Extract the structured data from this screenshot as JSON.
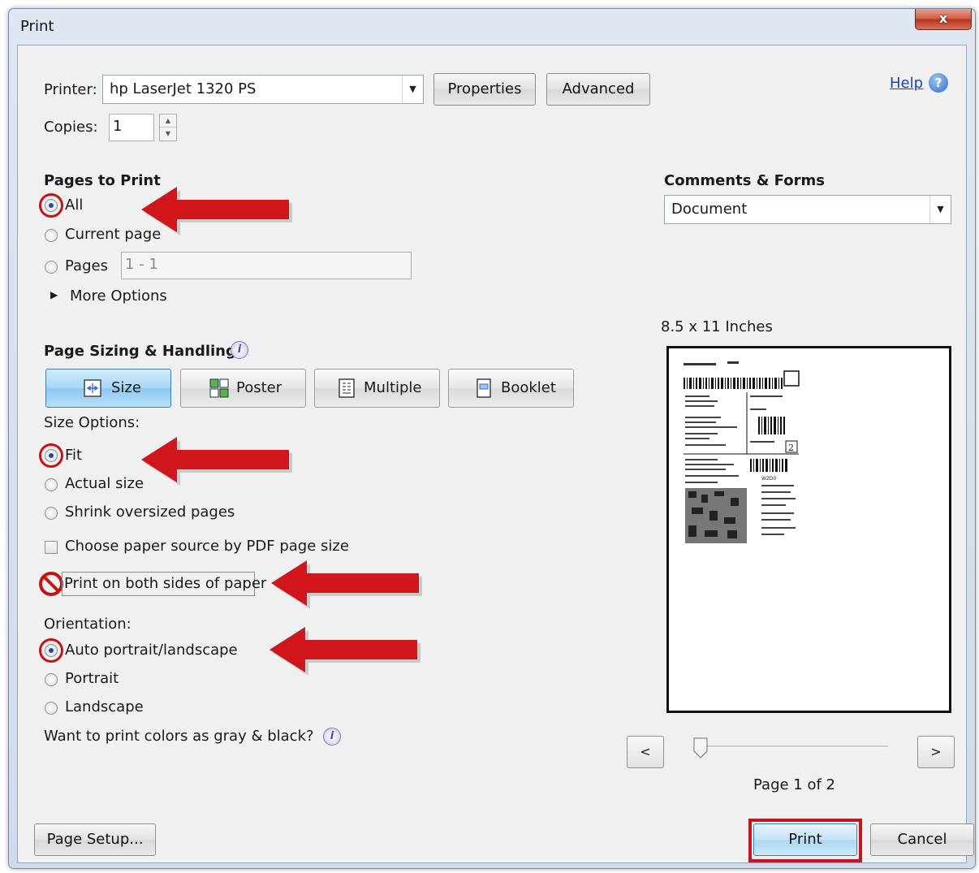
{
  "window": {
    "title": "Print",
    "close_glyph": "x"
  },
  "printer": {
    "label": "Printer:",
    "selected": "hp LaserJet 1320 PS",
    "properties_label": "Properties",
    "advanced_label": "Advanced",
    "copies_label": "Copies:",
    "copies_value": "1"
  },
  "help": {
    "label": "Help",
    "icon": "help-icon"
  },
  "pages_to_print": {
    "heading": "Pages to Print",
    "options": [
      {
        "label": "All",
        "selected": true
      },
      {
        "label": "Current page",
        "selected": false
      },
      {
        "label": "Pages",
        "selected": false
      }
    ],
    "pages_range": "1 - 1",
    "more_options": "More Options"
  },
  "page_sizing": {
    "heading": "Page Sizing & Handling",
    "tabs": [
      {
        "label": "Size",
        "active": true
      },
      {
        "label": "Poster",
        "active": false
      },
      {
        "label": "Multiple",
        "active": false
      },
      {
        "label": "Booklet",
        "active": false
      }
    ],
    "size_options_label": "Size Options:",
    "size_options": [
      {
        "label": "Fit",
        "selected": true
      },
      {
        "label": "Actual size",
        "selected": false
      },
      {
        "label": "Shrink oversized pages",
        "selected": false
      }
    ],
    "paper_source_label": "Choose paper source by PDF page size",
    "duplex_label": "Print on both sides of paper"
  },
  "orientation": {
    "label": "Orientation:",
    "options": [
      {
        "label": "Auto portrait/landscape",
        "selected": true
      },
      {
        "label": "Portrait",
        "selected": false
      },
      {
        "label": "Landscape",
        "selected": false
      }
    ],
    "grayscale_label": "Want to print colors as gray & black?"
  },
  "comments_forms": {
    "heading": "Comments & Forms",
    "selected": "Document"
  },
  "preview": {
    "size_label": "8.5 x 11 Inches",
    "page_status": "Page 1 of 2",
    "prev_label": "<",
    "next_label": ">",
    "slider_position": 0,
    "label_box_number": "2",
    "label_code": "W2D0"
  },
  "footer": {
    "page_setup_label": "Page Setup...",
    "print_label": "Print",
    "cancel_label": "Cancel"
  },
  "colors": {
    "annotation_red": "#d0161b",
    "accent_blue": "#2f6fc7"
  }
}
